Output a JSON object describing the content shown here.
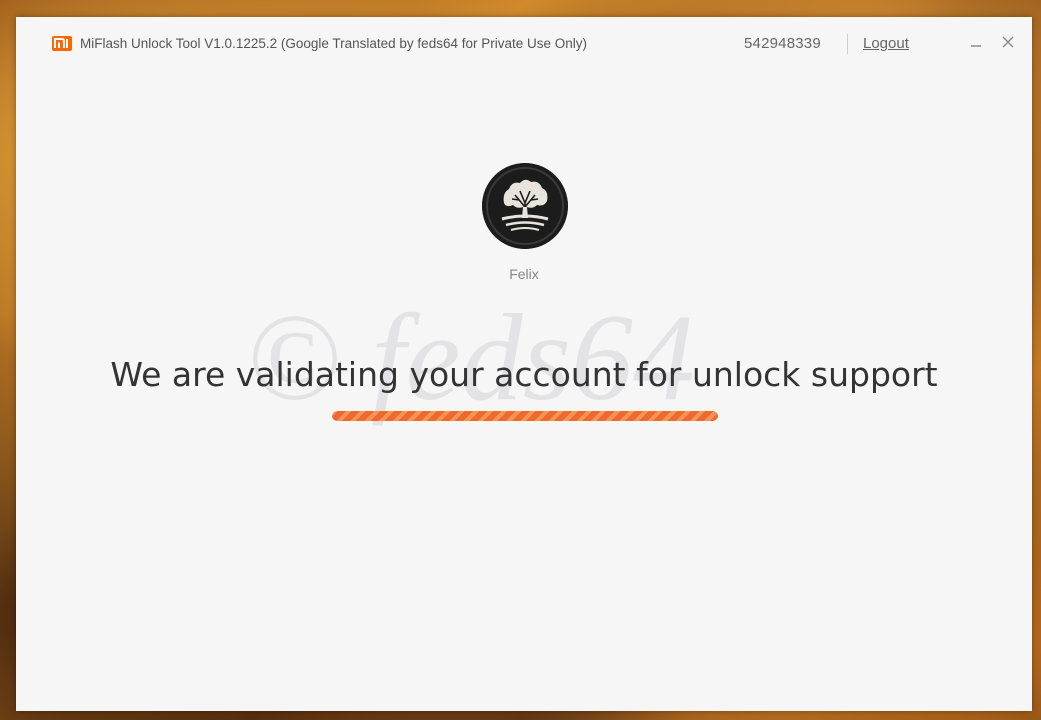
{
  "window": {
    "title": "MiFlash Unlock Tool V1.0.1225.2 (Google Translated by feds64 for Private Use Only)",
    "account_id": "542948339",
    "logout_label": "Logout"
  },
  "icons": {
    "logo": "mi-logo-icon",
    "minimize": "minimize-icon",
    "close": "close-icon",
    "avatar": "tree-avatar"
  },
  "user": {
    "name": "Felix"
  },
  "main": {
    "watermark": "© feds64",
    "status_message": "We are validating your account for unlock support",
    "progress": 1.0
  },
  "colors": {
    "brand": "#ff6700",
    "progress": "#ee6a2a",
    "background": "#f6f6f6"
  }
}
